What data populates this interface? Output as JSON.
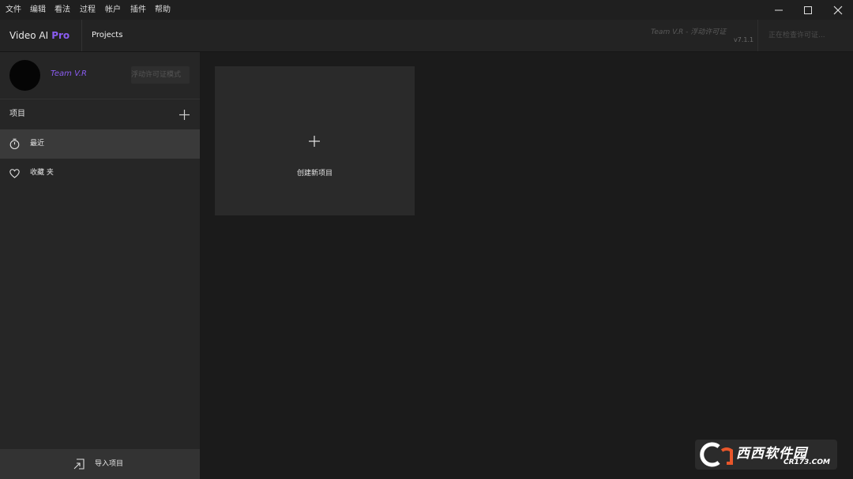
{
  "menu": {
    "items": [
      "文件",
      "编辑",
      "看法",
      "过程",
      "帐户",
      "插件",
      "帮助"
    ]
  },
  "header": {
    "brand": "Video AI",
    "brand_pro": "Pro",
    "tab": "Projects",
    "team": "Team V.R - 浮动许可证",
    "version": "v7.1.1",
    "status": "正在检查许可证..."
  },
  "sidebar": {
    "user": {
      "name": "Team V.R",
      "license_button": "浮动许可证模式"
    },
    "projects_label": "项目",
    "nav": [
      {
        "label": "最近",
        "icon": "stopwatch-icon",
        "active": true
      },
      {
        "label": "收藏 夹",
        "icon": "heart-icon",
        "active": false
      }
    ],
    "import_label": "导入项目"
  },
  "main": {
    "new_project_label": "创建新项目"
  },
  "watermark": {
    "brand": "西西软件园",
    "url": "CR173.COM"
  },
  "colors": {
    "accent": "#8a5cf0",
    "background": "#1b1b1b",
    "sidebar": "#262626",
    "active_item": "#3a3a3a"
  }
}
